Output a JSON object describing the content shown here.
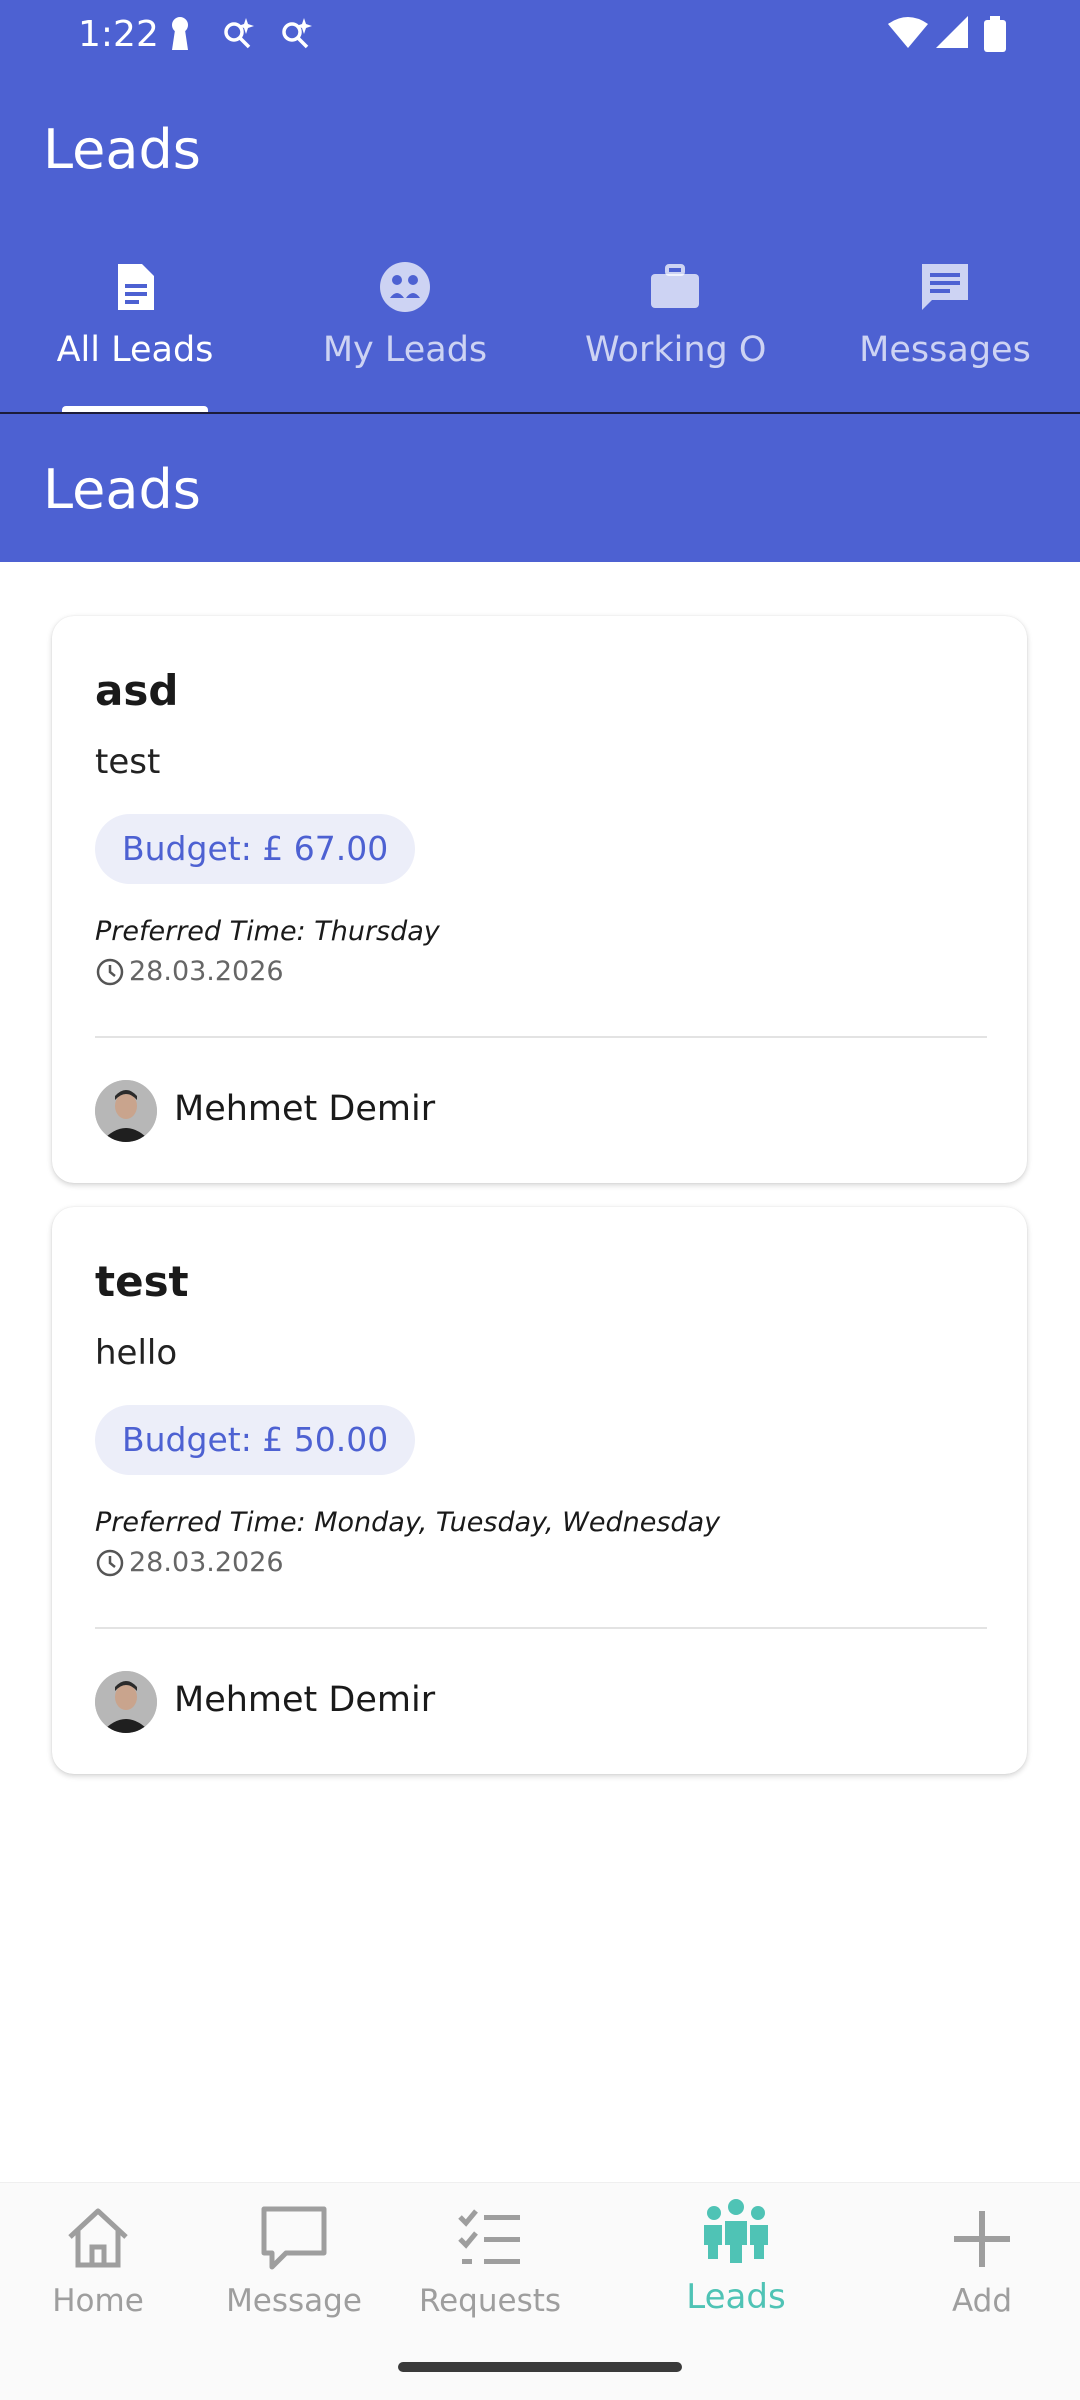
{
  "status_bar": {
    "time": "1:22"
  },
  "app_bar": {
    "title": "Leads"
  },
  "tabs": [
    {
      "label": "All Leads",
      "icon": "document-icon",
      "active": true
    },
    {
      "label": "My Leads",
      "icon": "group-icon",
      "active": false
    },
    {
      "label": "Working On",
      "icon": "briefcase-icon",
      "active": false
    },
    {
      "label": "Messages",
      "icon": "message-icon",
      "active": false
    }
  ],
  "section": {
    "title": "Leads"
  },
  "leads": [
    {
      "title": "asd",
      "description": "test",
      "budget": "Budget: £ 67.00",
      "preferred_time": "Preferred Time: Thursday",
      "date": "28.03.2026",
      "author": "Mehmet Demir"
    },
    {
      "title": "test",
      "description": "hello",
      "budget": "Budget: £ 50.00",
      "preferred_time": "Preferred Time: Monday, Tuesday, Wednesday",
      "date": "28.03.2026",
      "author": "Mehmet Demir"
    }
  ],
  "bottom_nav": [
    {
      "label": "Home",
      "icon": "home-icon",
      "active": false
    },
    {
      "label": "Message",
      "icon": "chat-bubble-icon",
      "active": false
    },
    {
      "label": "Requests",
      "icon": "checklist-icon",
      "active": false
    },
    {
      "label": "Leads",
      "icon": "people-icon",
      "active": true
    },
    {
      "label": "Add",
      "icon": "plus-icon",
      "active": false
    }
  ],
  "colors": {
    "primary": "#4d61d2",
    "active_nav": "#4fc3b5",
    "chip_background": "#eceef9"
  }
}
